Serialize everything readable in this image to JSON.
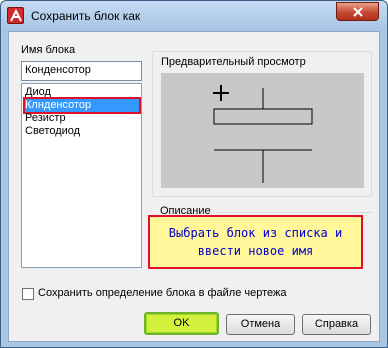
{
  "window": {
    "title": "Сохранить блок как"
  },
  "block_name": {
    "label": "Имя блока",
    "value": "Конденсотор",
    "items": [
      "Диод",
      "Клнденсотор",
      "Резистр",
      "Светодиод"
    ],
    "selected_index": 1
  },
  "preview": {
    "label": "Предварительный просмотр"
  },
  "description": {
    "label": "Описание"
  },
  "annotation": {
    "line1": "Выбрать блок из списка и",
    "line2": "ввести новое имя"
  },
  "save_definition": {
    "label": "Сохранить определение блока в файле чертежа",
    "checked": false
  },
  "buttons": {
    "ok": "OK",
    "cancel": "Отмена",
    "help": "Справка"
  },
  "colors": {
    "highlight": "#e0102a",
    "selection": "#3399ff",
    "annotation_bg": "#fff799",
    "annotation_text": "#0000cc",
    "ok_button": "#d4f03c"
  }
}
